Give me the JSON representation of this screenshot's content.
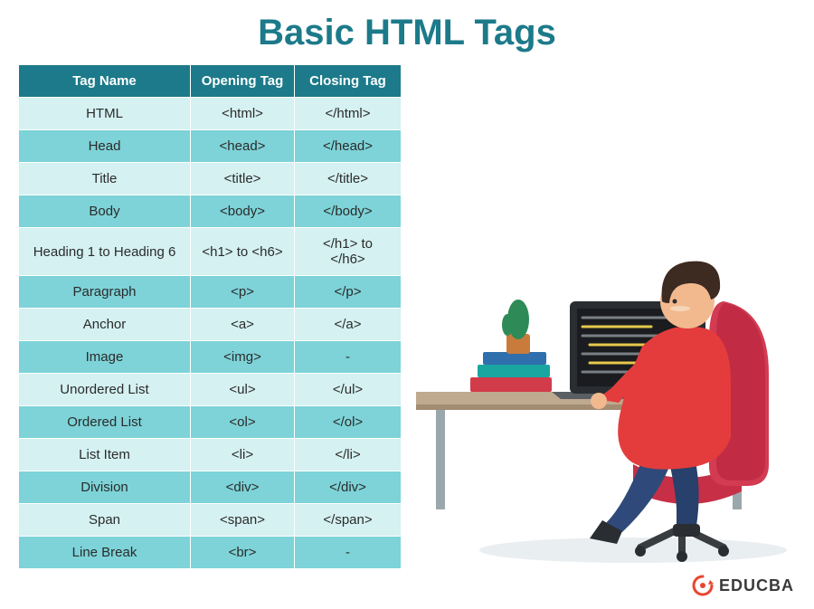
{
  "title": "Basic HTML Tags",
  "columns": [
    "Tag Name",
    "Opening Tag",
    "Closing Tag"
  ],
  "rows": [
    {
      "name": "HTML",
      "open": "<html>",
      "close": "</html>"
    },
    {
      "name": "Head",
      "open": "<head>",
      "close": "</head>"
    },
    {
      "name": "Title",
      "open": "<title>",
      "close": "</title>"
    },
    {
      "name": "Body",
      "open": "<body>",
      "close": "</body>"
    },
    {
      "name": "Heading 1 to Heading 6",
      "open": "<h1> to <h6>",
      "close": "</h1> to </h6>"
    },
    {
      "name": "Paragraph",
      "open": "<p>",
      "close": "</p>"
    },
    {
      "name": "Anchor",
      "open": "<a>",
      "close": "</a>"
    },
    {
      "name": "Image",
      "open": "<img>",
      "close": "-"
    },
    {
      "name": "Unordered List",
      "open": "<ul>",
      "close": "</ul>"
    },
    {
      "name": "Ordered List",
      "open": "<ol>",
      "close": "</ol>"
    },
    {
      "name": "List Item",
      "open": "<li>",
      "close": "</li>"
    },
    {
      "name": "Division",
      "open": "<div>",
      "close": "</div>"
    },
    {
      "name": "Span",
      "open": "<span>",
      "close": "</span>"
    },
    {
      "name": "Line Break",
      "open": "<br>",
      "close": "-"
    }
  ],
  "logo_text": "EDUCBA"
}
